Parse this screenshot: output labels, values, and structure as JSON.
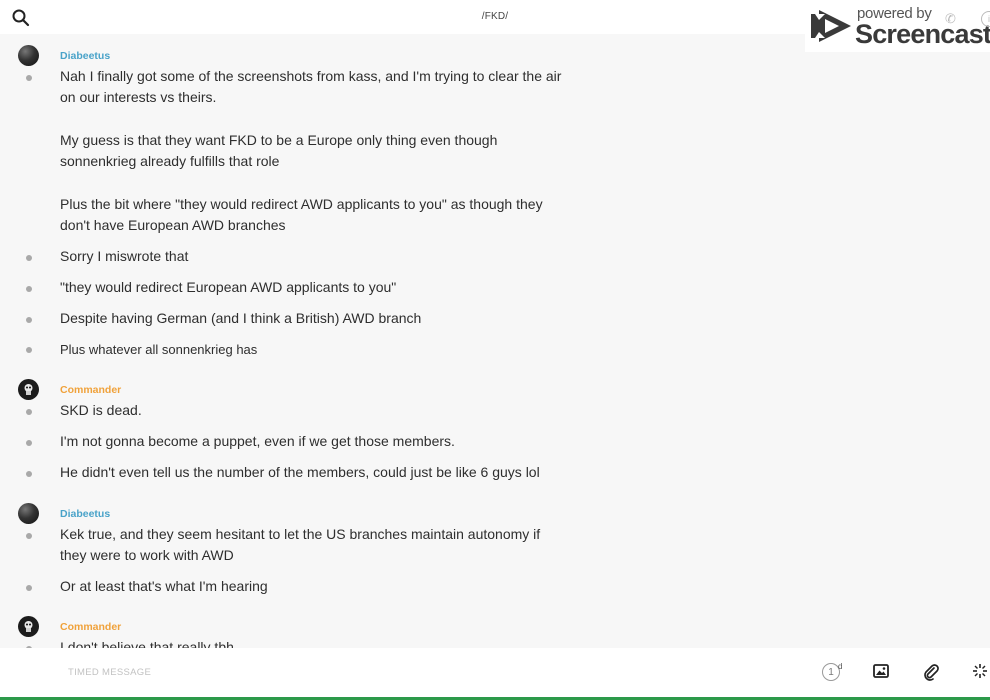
{
  "header": {
    "channel": "/FKD/"
  },
  "watermark": {
    "line1": "powered by",
    "line2": "Screencastify"
  },
  "groups": [
    {
      "author": "Diabeetus",
      "messages": [
        "Nah I finally got some of the screenshots from kass, and I'm trying to clear the air on our interests vs theirs.",
        "My guess is that they want FKD to be a Europe only thing even though sonnenkrieg already fulfills that role",
        "Plus the bit where \"they would redirect AWD applicants to you\" as though they don't have European AWD branches",
        "Sorry I miswrote that",
        "\"they would redirect European AWD applicants to you\"",
        "Despite having German (and I think a British) AWD branch",
        "Plus whatever all sonnenkrieg has"
      ]
    },
    {
      "author": "Commander",
      "messages": [
        "SKD is dead.",
        "I'm not gonna become a puppet, even if we get those members.",
        "He didn't even tell us the number of the members, could just be like 6 guys lol"
      ]
    },
    {
      "author": "Diabeetus",
      "messages": [
        "Kek true, and they seem hesitant to let the US branches maintain autonomy if they were to work with AWD",
        "Or at least that's what I'm hearing"
      ]
    },
    {
      "author": "Commander",
      "messages": [
        "I don't believe that really tbh"
      ]
    }
  ],
  "composer": {
    "placeholder": "TIMED MESSAGE",
    "counter": "1",
    "counter_unit": "d"
  },
  "colors": {
    "author_blue": "#4aa3c9",
    "author_orange": "#f0a23b",
    "accent_green": "#2c9a4a"
  },
  "icons": [
    "search-icon",
    "image-icon",
    "paperclip-icon",
    "sparkle-icon",
    "phone-icon",
    "info-icon"
  ]
}
